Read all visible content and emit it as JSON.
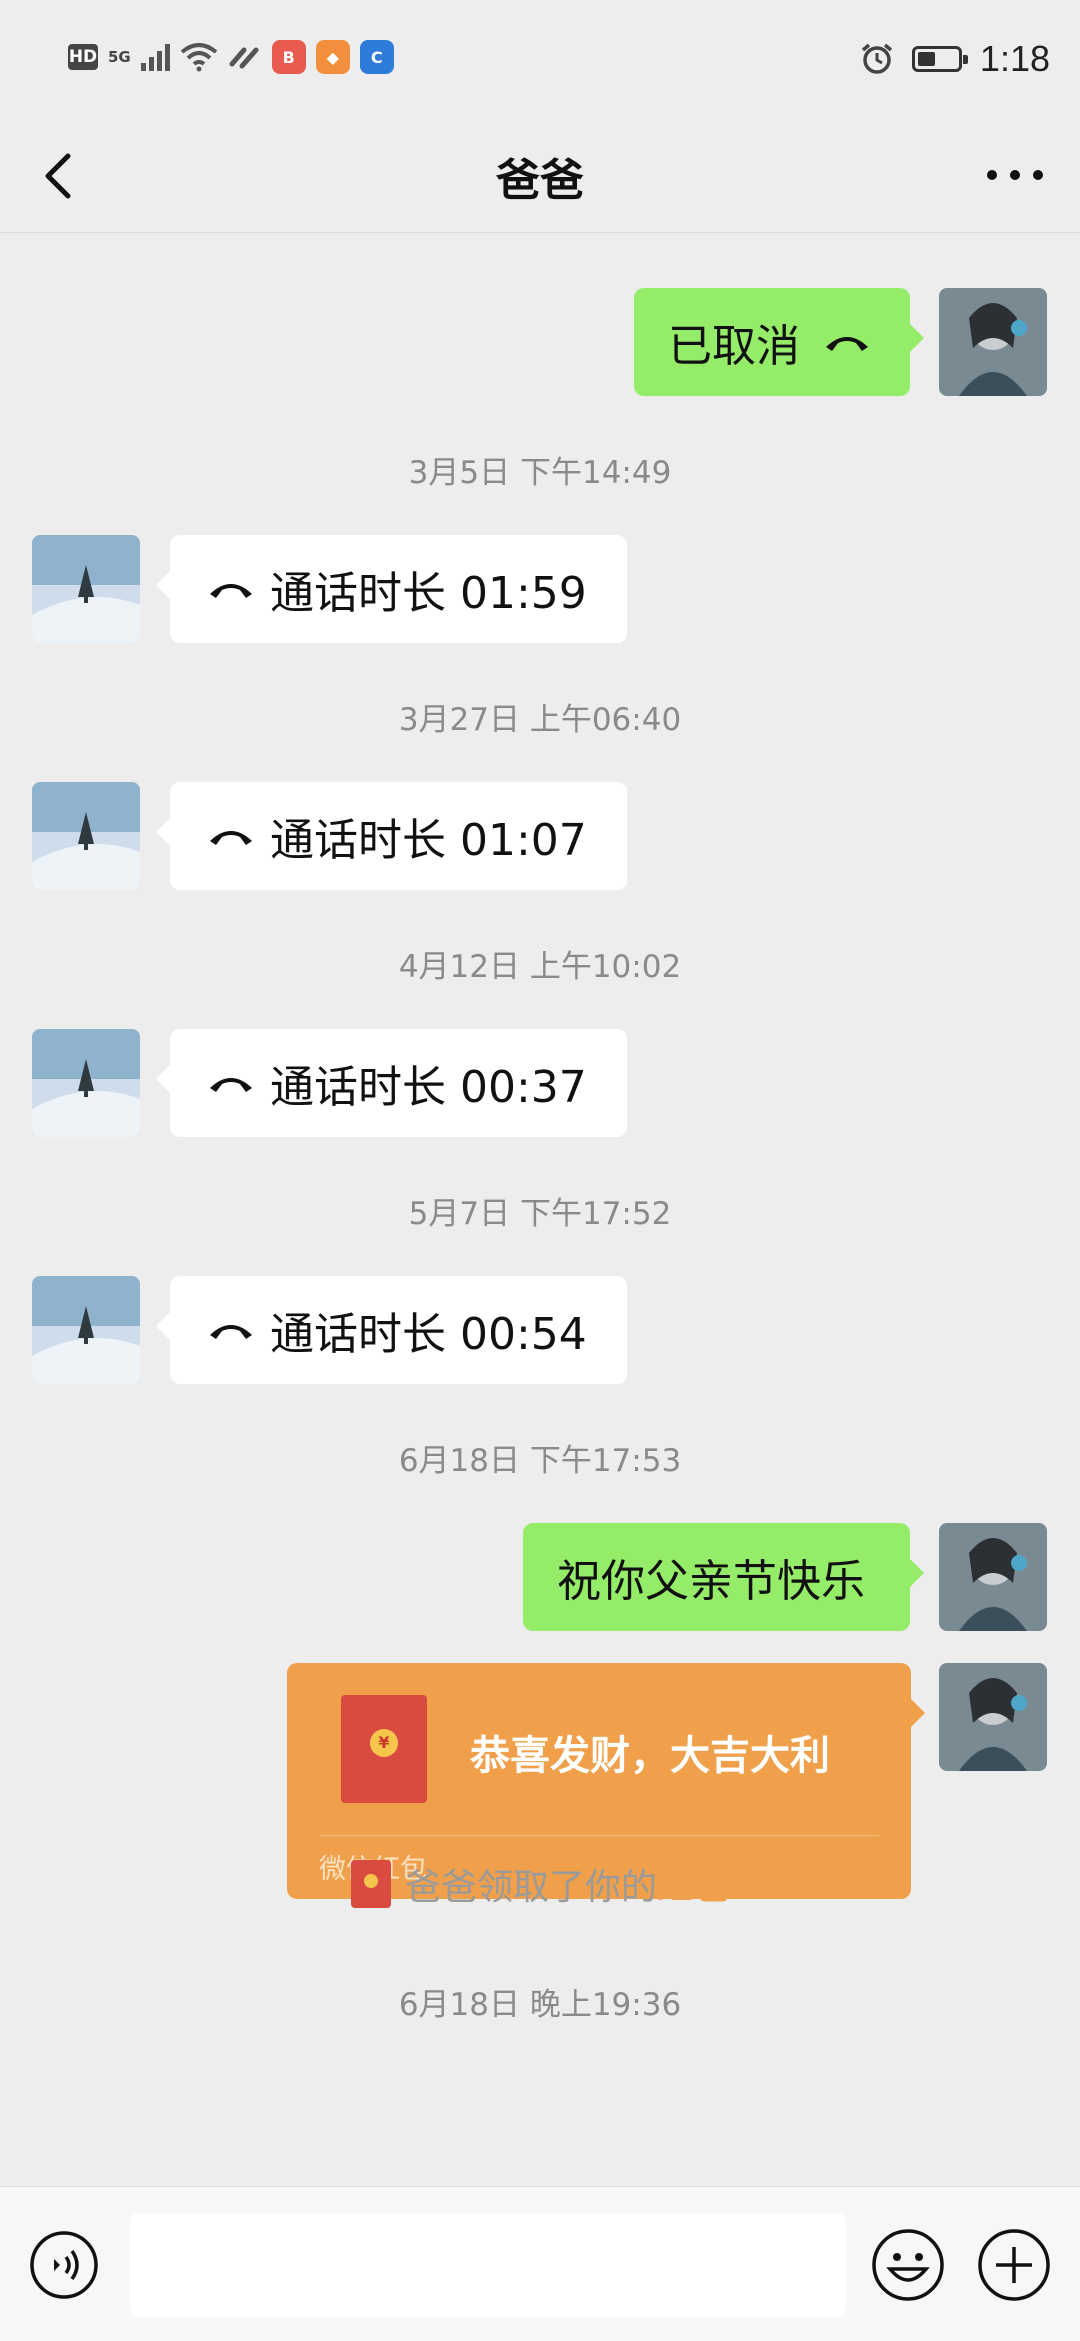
{
  "status_bar": {
    "hd": "HD",
    "network": "5G",
    "time": "1:18",
    "battery_level": 0.45
  },
  "nav": {
    "title": "爸爸",
    "back_icon": "chevron-left-icon",
    "more_icon": "more-horizontal-icon"
  },
  "messages": [
    {
      "type": "text",
      "from": "me",
      "text": "已取消",
      "icon": "phone-hangup-icon"
    },
    {
      "type": "timestamp",
      "text": "3月5日 下午14:49"
    },
    {
      "type": "call",
      "from": "other",
      "text": "通话时长 01:59",
      "icon": "phone-hangup-icon"
    },
    {
      "type": "timestamp",
      "text": "3月27日 上午06:40"
    },
    {
      "type": "call",
      "from": "other",
      "text": "通话时长 01:07",
      "icon": "phone-hangup-icon"
    },
    {
      "type": "timestamp",
      "text": "4月12日 上午10:02"
    },
    {
      "type": "call",
      "from": "other",
      "text": "通话时长 00:37",
      "icon": "phone-hangup-icon"
    },
    {
      "type": "timestamp",
      "text": "5月7日 下午17:52"
    },
    {
      "type": "call",
      "from": "other",
      "text": "通话时长 00:54",
      "icon": "phone-hangup-icon"
    },
    {
      "type": "timestamp",
      "text": "6月18日 下午17:53"
    },
    {
      "type": "text",
      "from": "me",
      "text": "祝你父亲节快乐"
    },
    {
      "type": "red_packet",
      "from": "me",
      "title": "恭喜发财，大吉大利",
      "label": "微信红包"
    },
    {
      "type": "timestamp",
      "text": "6月18日 晚上19:36"
    },
    {
      "type": "notice",
      "prefix": "爸爸领取了你的",
      "link": "红包"
    }
  ],
  "input_bar": {
    "voice_icon": "voice-input-icon",
    "text_value": "",
    "emoji_icon": "emoji-icon",
    "plus_icon": "plus-icon"
  },
  "colors": {
    "background": "#ededed",
    "my_bubble": "#95ec69",
    "other_bubble": "#ffffff",
    "red_packet": "#f0a04b",
    "link": "#f0a04b"
  }
}
